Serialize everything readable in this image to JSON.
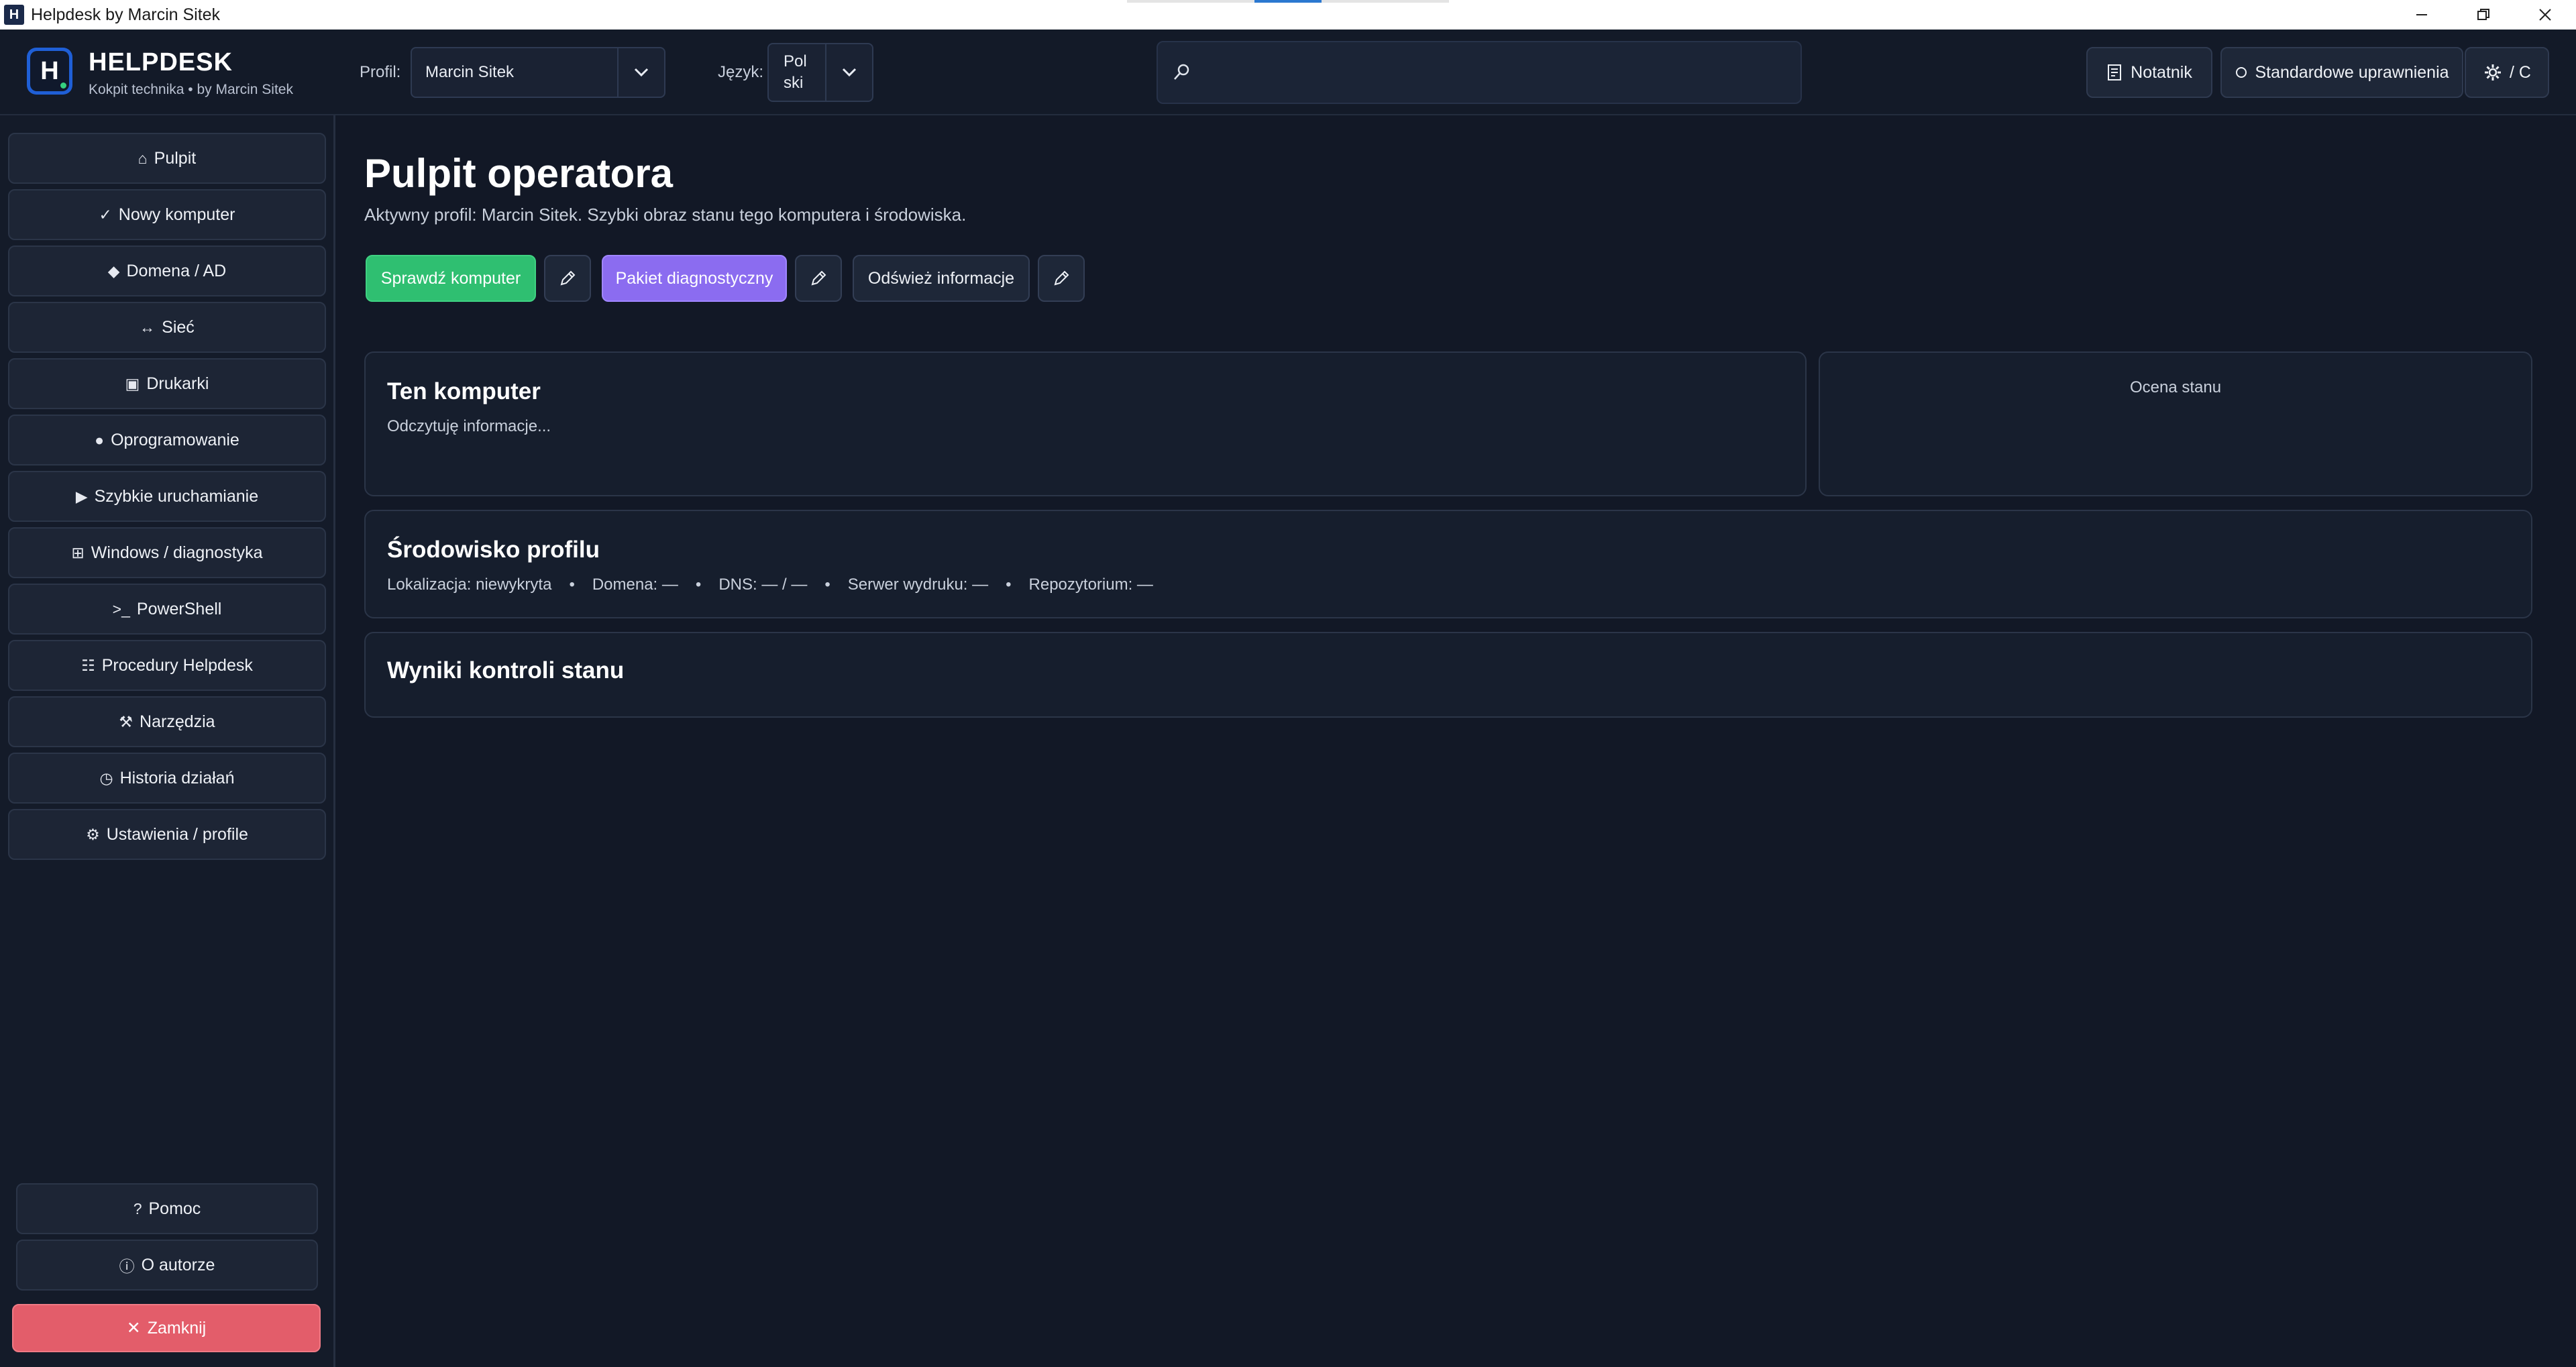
{
  "window": {
    "title": "Helpdesk by Marcin Sitek",
    "icon_letter": "H"
  },
  "header": {
    "brand_title": "HELPDESK",
    "brand_sub": "Kokpit technika • by Marcin Sitek",
    "profile_label": "Profil:",
    "profile_value": "Marcin Sitek",
    "language_label": "Język:",
    "language_value": "Pol\nski",
    "search_placeholder": "",
    "notes_button": "Notatnik",
    "permissions_button": "Standardowe uprawnienia",
    "theme_button": "/ C"
  },
  "sidebar": {
    "items": [
      {
        "icon": "⌂",
        "label": "Pulpit"
      },
      {
        "icon": "✓",
        "label": "Nowy komputer"
      },
      {
        "icon": "◆",
        "label": "Domena / AD"
      },
      {
        "icon": "↔",
        "label": "Sieć"
      },
      {
        "icon": "▣",
        "label": "Drukarki"
      },
      {
        "icon": "●",
        "label": "Oprogramowanie"
      },
      {
        "icon": "▶",
        "label": "Szybkie uruchamianie"
      },
      {
        "icon": "⊞",
        "label": "Windows / diagnostyka"
      },
      {
        "icon": ">_",
        "label": "PowerShell"
      },
      {
        "icon": "☷",
        "label": "Procedury Helpdesk"
      },
      {
        "icon": "⚒",
        "label": "Narzędzia"
      },
      {
        "icon": "◷",
        "label": "Historia działań"
      },
      {
        "icon": "⚙",
        "label": "Ustawienia / profile"
      }
    ],
    "help": {
      "icon": "?",
      "label": "Pomoc"
    },
    "about": {
      "icon": "ⓘ",
      "label": "O autorze"
    },
    "close": {
      "icon": "✕",
      "label": "Zamknij"
    }
  },
  "main": {
    "title": "Pulpit operatora",
    "subtitle": "Aktywny profil: Marcin Sitek. Szybki obraz stanu tego komputera i środowiska.",
    "actions": {
      "check": "Sprawdź komputer",
      "diag": "Pakiet diagnostyczny",
      "refresh": "Odśwież informacje"
    },
    "computer_card": {
      "title": "Ten komputer",
      "text": "Odczytuję informacje..."
    },
    "rating_card": {
      "title": "Ocena stanu"
    },
    "env_card": {
      "title": "Środowisko profilu",
      "location": "Lokalizacja: niewykryta",
      "domain": "Domena: —",
      "dns": "DNS: — / —",
      "print_server": "Serwer wydruku: —",
      "repository": "Repozytorium: —",
      "separator": "•"
    },
    "results_card": {
      "title": "Wyniki kontroli stanu"
    }
  },
  "colors": {
    "background": "#121826",
    "accent_green": "#2fbf71",
    "accent_purple": "#8b6cf0",
    "danger": "#e35d6a",
    "logo_blue": "#1f5fd6"
  }
}
